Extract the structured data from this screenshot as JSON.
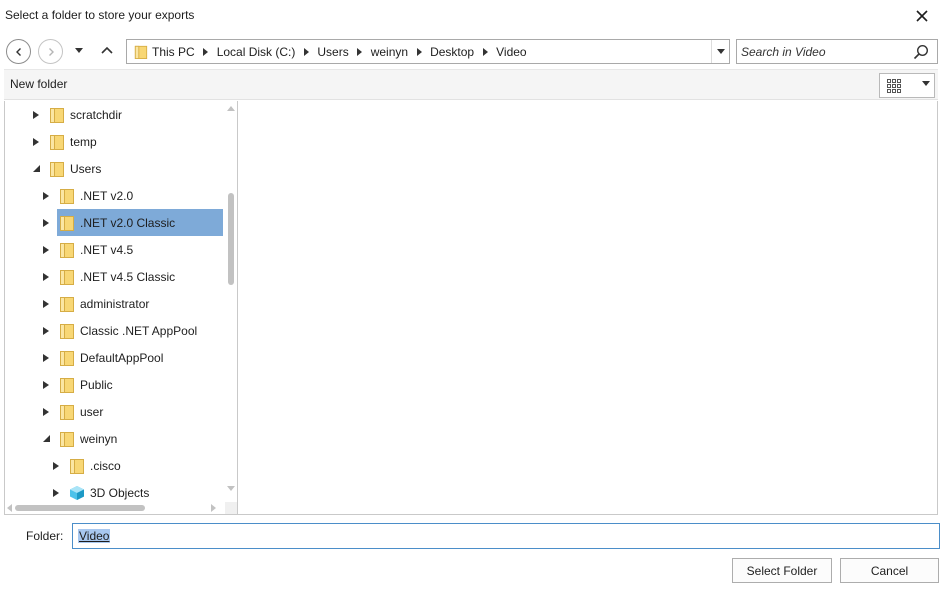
{
  "dialog": {
    "title": "Select a folder to store your exports"
  },
  "address_bar": {
    "crumbs": [
      "This PC",
      "Local Disk (C:)",
      "Users",
      "weinyn",
      "Desktop",
      "Video"
    ]
  },
  "search": {
    "placeholder": "Search in Video"
  },
  "toolbar": {
    "new_folder_label": "New folder"
  },
  "tree": {
    "items": [
      {
        "label": "scratchdir",
        "expanded": false,
        "level": 0,
        "icon": "folder-icon"
      },
      {
        "label": "temp",
        "expanded": false,
        "level": 0,
        "icon": "folder-icon"
      },
      {
        "label": "Users",
        "expanded": true,
        "level": 0,
        "icon": "folder-icon"
      },
      {
        "label": ".NET v2.0",
        "expanded": false,
        "level": 1,
        "icon": "folder-icon"
      },
      {
        "label": ".NET v2.0 Classic",
        "expanded": false,
        "level": 1,
        "icon": "folder-icon",
        "selected": true
      },
      {
        "label": ".NET v4.5",
        "expanded": false,
        "level": 1,
        "icon": "folder-icon"
      },
      {
        "label": ".NET v4.5 Classic",
        "expanded": false,
        "level": 1,
        "icon": "folder-icon"
      },
      {
        "label": "administrator",
        "expanded": false,
        "level": 1,
        "icon": "folder-icon"
      },
      {
        "label": "Classic .NET AppPool",
        "expanded": false,
        "level": 1,
        "icon": "folder-icon"
      },
      {
        "label": "DefaultAppPool",
        "expanded": false,
        "level": 1,
        "icon": "folder-icon"
      },
      {
        "label": "Public",
        "expanded": false,
        "level": 1,
        "icon": "folder-icon"
      },
      {
        "label": "user",
        "expanded": false,
        "level": 1,
        "icon": "folder-icon"
      },
      {
        "label": "weinyn",
        "expanded": true,
        "level": 1,
        "icon": "folder-icon"
      },
      {
        "label": ".cisco",
        "expanded": false,
        "level": 2,
        "icon": "folder-icon"
      },
      {
        "label": "3D Objects",
        "expanded": false,
        "level": 2,
        "icon": "3d-objects-icon"
      }
    ]
  },
  "folder_field": {
    "label": "Folder:",
    "value": "Video"
  },
  "buttons": {
    "select_folder": "Select Folder",
    "cancel": "Cancel"
  },
  "colors": {
    "selection": "#7eaad8",
    "focus_border": "#4b8ec9",
    "folder_yellow": "#f8d775"
  }
}
